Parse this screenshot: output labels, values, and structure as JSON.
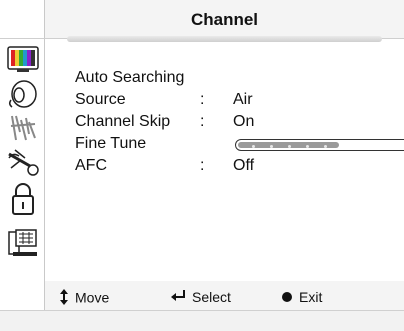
{
  "header": {
    "title": "Channel"
  },
  "sidebar": {
    "icons": [
      "tv-picture-icon",
      "sound-icon",
      "channel-antenna-icon",
      "satellite-setup-icon",
      "lock-icon",
      "input-pc-icon"
    ]
  },
  "menu": {
    "items": [
      {
        "label": "Auto Searching",
        "colon": "",
        "value": ""
      },
      {
        "label": "Source",
        "colon": ":",
        "value": "Air"
      },
      {
        "label": "Channel Skip",
        "colon": ":",
        "value": "On"
      },
      {
        "label": "Fine Tune",
        "colon": "",
        "value": ""
      },
      {
        "label": "AFC",
        "colon": ":",
        "value": "Off"
      }
    ],
    "fine_tune_level": 0.58
  },
  "footer": {
    "move_label": "Move",
    "select_label": "Select",
    "exit_label": "Exit"
  }
}
